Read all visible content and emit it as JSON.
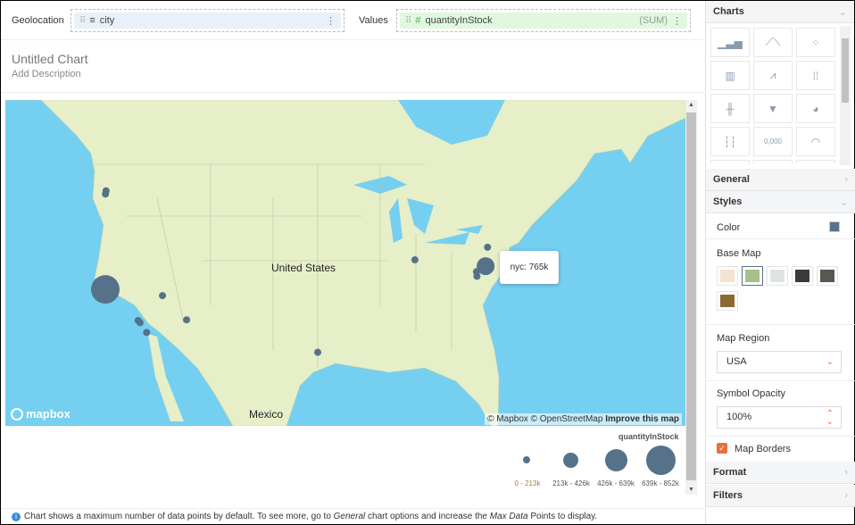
{
  "shelf": {
    "geolocation_label": "Geolocation",
    "geolocation_field": "city",
    "values_label": "Values",
    "values_field": "quantityInStock",
    "values_agg": "(SUM)"
  },
  "chart": {
    "title": "Untitled Chart",
    "description": "Add Description"
  },
  "map": {
    "country_label": "United States",
    "mexico_label": "Mexico",
    "logo": "mapbox",
    "attribution": "© Mapbox © OpenStreetMap",
    "improve": "Improve this map",
    "tooltip": "nyc: 765k",
    "symbol_color": "#56728a",
    "water_color": "#75cff0",
    "land_color": "#e6efc8",
    "points": [
      {
        "lon": -122.33,
        "lat": 47.61,
        "size": "0 - 213k"
      },
      {
        "lon": -122.4,
        "lat": 47.3,
        "size": "0 - 213k"
      },
      {
        "lon": -122.42,
        "lat": 37.77,
        "size": "639k - 852k"
      },
      {
        "lon": -118.24,
        "lat": 34.05,
        "size": "0 - 213k"
      },
      {
        "lon": -118.0,
        "lat": 33.8,
        "size": "0 - 213k"
      },
      {
        "lon": -117.16,
        "lat": 32.72,
        "size": "0 - 213k"
      },
      {
        "lon": -115.14,
        "lat": 36.17,
        "size": "0 - 213k"
      },
      {
        "lon": -112.07,
        "lat": 33.45,
        "size": "0 - 213k"
      },
      {
        "lon": -95.37,
        "lat": 29.76,
        "size": "0 - 213k"
      },
      {
        "lon": -83.0,
        "lat": 39.96,
        "size": "0 - 213k"
      },
      {
        "lon": -73.75,
        "lat": 42.65,
        "size": "0 - 213k"
      },
      {
        "lon": -74.0,
        "lat": 40.71,
        "size": "639k - 852k"
      },
      {
        "lon": -75.16,
        "lat": 39.95,
        "size": "0 - 213k"
      },
      {
        "lon": -75.1,
        "lat": 39.5,
        "size": "0 - 213k"
      },
      {
        "lon": -71.4,
        "lat": 41.82,
        "size": "0 - 213k"
      },
      {
        "lon": -71.06,
        "lat": 42.36,
        "size": "0 - 213k"
      },
      {
        "lon": -71.2,
        "lat": 41.5,
        "size": "0 - 213k"
      }
    ]
  },
  "legend": {
    "title": "quantityInStock",
    "bins": [
      "0 - 213k",
      "213k - 426k",
      "426k - 639k",
      "639k - 852k"
    ]
  },
  "footer": {
    "pre": "Chart shows a maximum number of data points by default. To see more, go to ",
    "general": "General",
    "mid": " chart options and increase the ",
    "max": "Max Data",
    "post": " Points to display."
  },
  "panel": {
    "charts": "Charts",
    "general": "General",
    "styles": "Styles",
    "color_label": "Color",
    "color_value": "#56728a",
    "base_map": "Base Map",
    "base_maps": [
      "#f3e3d0",
      "#a8bf8a",
      "#e0e3e4",
      "#3a3a3a",
      "#555a50",
      "#8a6a30"
    ],
    "map_region_label": "Map Region",
    "map_region": "USA",
    "opacity_label": "Symbol Opacity",
    "opacity": "100%",
    "map_borders": "Map Borders",
    "map_borders_checked": true,
    "format": "Format",
    "filters": "Filters",
    "chart_icons": [
      "bar",
      "line",
      "scatter",
      "stacked-bar",
      "area",
      "dot-plot",
      "box",
      "funnel",
      "pie",
      "range",
      "kpi",
      "gauge"
    ],
    "kpi_text": "0,000"
  }
}
